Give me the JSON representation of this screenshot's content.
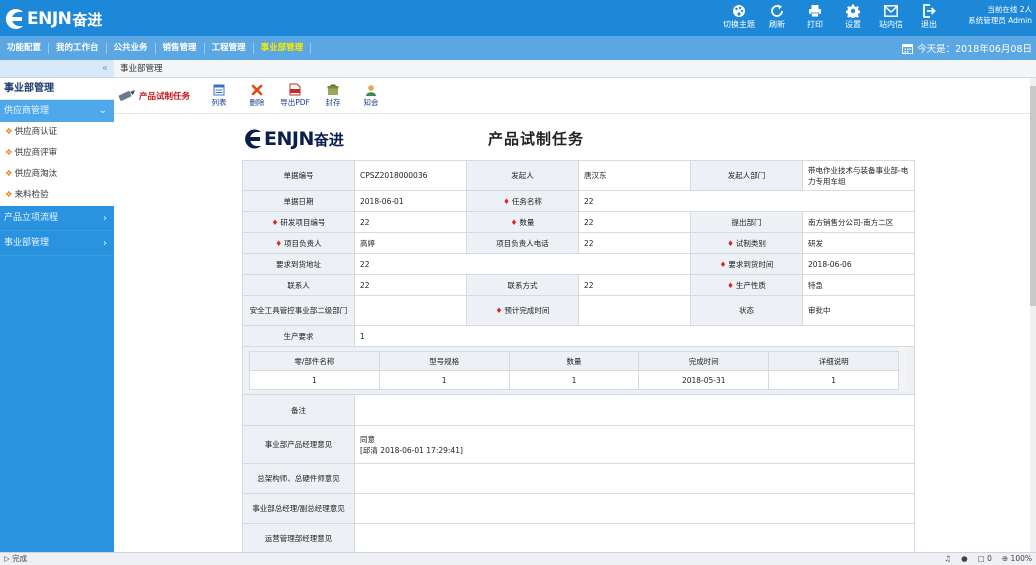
{
  "app": {
    "logo_text": "ENJN",
    "logo_cn": "奋进"
  },
  "top_actions": [
    {
      "icon": "palette-icon",
      "label": "切换主题"
    },
    {
      "icon": "refresh-icon",
      "label": "刷新"
    },
    {
      "icon": "printer-icon",
      "label": "打印"
    },
    {
      "icon": "gear-icon",
      "label": "设置"
    },
    {
      "icon": "mail-icon",
      "label": "站内信"
    },
    {
      "icon": "logout-icon",
      "label": "退出"
    }
  ],
  "online": {
    "line1": "当前在线 2人",
    "line2": "系统管理员 Admin"
  },
  "menu": [
    "功能配置",
    "我的工作台",
    "公共业务",
    "销售管理",
    "工程管理",
    "事业部管理"
  ],
  "menu_active": "事业部管理",
  "today": "今天是：2018年06月08日",
  "sidebar": {
    "collapse": "«",
    "title": "事业部管理",
    "group_open": "供应商管理",
    "subitems": [
      "供应商认证",
      "供应商评审",
      "供应商淘汰",
      "来料检验"
    ],
    "groups": [
      "产品立项流程",
      "事业部管理"
    ]
  },
  "breadcrumb": "事业部管理",
  "toolbar": {
    "task_title": "产品试制任务",
    "buttons": [
      {
        "icon": "list-icon",
        "label": "列表"
      },
      {
        "icon": "delete-icon",
        "label": "删除"
      },
      {
        "icon": "pdf-icon",
        "label": "导出PDF"
      },
      {
        "icon": "archive-icon",
        "label": "封存"
      },
      {
        "icon": "user-icon",
        "label": "知会"
      }
    ]
  },
  "doc": {
    "logo_text": "ENJN",
    "logo_cn": "奋进",
    "title": "产品试制任务",
    "rows": {
      "r1": {
        "l1": "单据编号",
        "v1": "CPSZ2018000036",
        "l2": "发起人",
        "v2": "唐汉东",
        "l3": "发起人部门",
        "v3": "带电作业技术与装备事业部-电力专用车组"
      },
      "r2": {
        "l1": "单据日期",
        "v1": "2018-06-01",
        "l2": "任务名称",
        "v2": "22"
      },
      "r3": {
        "l1": "研发项目编号",
        "v1": "22",
        "l2": "数量",
        "v2": "22",
        "l3": "提出部门",
        "v3": "南方销售分公司-南方二区"
      },
      "r4": {
        "l1": "项目负责人",
        "v1": "高婷",
        "l2": "项目负责人电话",
        "v2": "22",
        "l3": "试制类别",
        "v3": "研发"
      },
      "r5": {
        "l1": "要求到货地址",
        "v1": "22",
        "l3": "要求到货时间",
        "v3": "2018-06-06"
      },
      "r6": {
        "l1": "联系人",
        "v1": "22",
        "l2": "联系方式",
        "v2": "22",
        "l3": "生产性质",
        "v3": "特急"
      },
      "r7": {
        "l1": "安全工具管控事业部二级部门",
        "v1": "",
        "l2": "预计完成时间",
        "v2": "",
        "l3": "状态",
        "v3": "审批中"
      },
      "r8": {
        "l1": "生产要求",
        "v1": "1"
      }
    },
    "parts": {
      "headers": [
        "零/部件名称",
        "型号规格",
        "数量",
        "完成时间",
        "详细说明"
      ],
      "rows": [
        [
          "1",
          "1",
          "1",
          "2018-05-31",
          "1"
        ]
      ]
    },
    "remarks": {
      "beizhu": "备注",
      "op1_label": "事业部产品经理意见",
      "op1_text": "同意",
      "op1_sign": "[邱清 2018-06-01 17:29:41]",
      "op2_label": "总架构师、总硬件师意见",
      "op3_label": "事业部总经理/副总经理意见",
      "op4_label": "运营管理部经理意见"
    }
  },
  "status": {
    "left": "完成",
    "right": [
      "0",
      "0",
      "100%"
    ]
  }
}
